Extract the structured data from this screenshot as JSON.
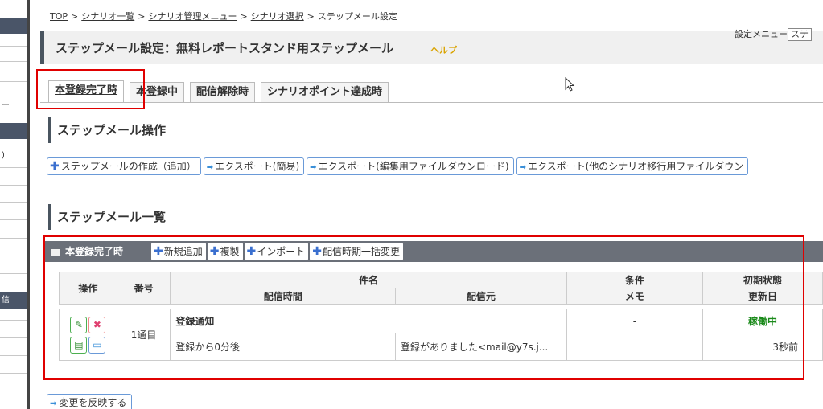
{
  "sidebar": {
    "fragments": [
      "ー",
      ")",
      "信"
    ]
  },
  "breadcrumb": {
    "items": [
      "TOP",
      "シナリオ一覧",
      "シナリオ管理メニュー",
      "シナリオ選択",
      "ステップメール設定"
    ],
    "separator": ">"
  },
  "header": {
    "title": "ステップメール設定：無料レポートスタンド用ステップメール",
    "help": "ヘルプ",
    "settings_label": "設定メニュー",
    "settings_value": "ステ"
  },
  "tabs": [
    {
      "label": "本登録完了時",
      "active": true
    },
    {
      "label": "本登録中",
      "active": false
    },
    {
      "label": "配信解除時",
      "active": false
    },
    {
      "label": "シナリオポイント達成時",
      "active": false
    }
  ],
  "operations": {
    "heading": "ステップメール操作",
    "buttons": [
      "ステップメールの作成（追加）",
      "エクスポート(簡易)",
      "エクスポート(編集用ファイルダウンロード)",
      "エクスポート(他のシナリオ移行用ファイルダウン"
    ]
  },
  "list": {
    "heading": "ステップメール一覧",
    "panel_title": "本登録完了時",
    "panel_buttons": [
      "新規追加",
      "複製",
      "インポート",
      "配信時期一括変更"
    ],
    "columns": {
      "ops": "操作",
      "number": "番号",
      "subject": "件名",
      "timing": "配信時間",
      "sender": "配信元",
      "condition": "条件",
      "memo": "メモ",
      "initial_state": "初期状態",
      "updated": "更新日"
    },
    "rows": [
      {
        "number": "1通目",
        "subject": "登録通知",
        "condition": "-",
        "state": "稼働中",
        "timing": "登録から0分後",
        "sender": "登録がありました<mail@y7s.j...",
        "memo": "",
        "updated": "3秒前"
      }
    ]
  },
  "apply_button": "変更を反映する",
  "colors": {
    "accent_blue": "#3a6fcf",
    "highlight_red": "#e00000",
    "status_green": "#1a8a1a",
    "panel_gray": "#6b7079"
  }
}
